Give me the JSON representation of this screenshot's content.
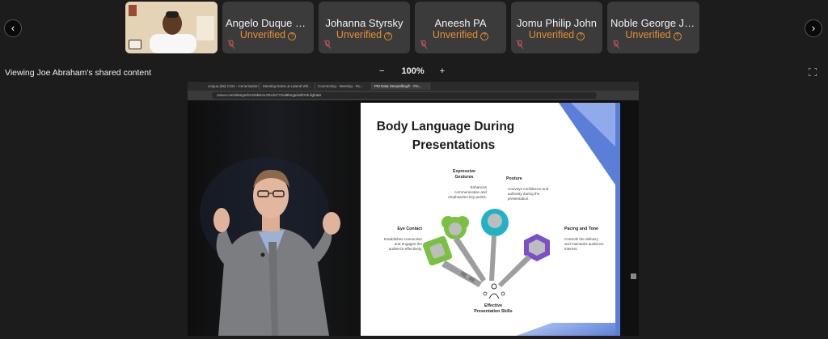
{
  "participants": [
    {
      "name": "Angelo Duque PMP",
      "status": "Unverified"
    },
    {
      "name": "Johanna Styrsky",
      "status": "Unverified"
    },
    {
      "name": "Aneesh PA",
      "status": "Unverified"
    },
    {
      "name": "Jomu Philip John",
      "status": "Unverified"
    },
    {
      "name": "Noble George Jos...",
      "status": "Unverified"
    }
  ],
  "sharing_label": "Viewing Joe Abraham's shared content",
  "zoom": {
    "minus": "−",
    "level": "100%",
    "plus": "+"
  },
  "browser": {
    "tabs": [
      "Joiqua (56) CSIs - Cenerisation",
      "Meeting Notes & Lateral Wh...",
      "Connecting - Meeting - Ro...",
      "PM Data Storytelling® - Fin..."
    ],
    "url": "canva.com/design/DAG6kNAxYEU/uT7Gai8bngp/edit?ek-light&ir"
  },
  "slide": {
    "title_line1": "Body Language During",
    "title_line2": "Presentations",
    "items": {
      "gestures": {
        "label_line1": "Expressive",
        "label_line2": "Gestures",
        "desc": [
          "Enhances",
          "communication and",
          "emphasizes key points."
        ]
      },
      "posture": {
        "label": "Posture",
        "desc": [
          "Conveys confidence and",
          "authority during the",
          "presentation."
        ]
      },
      "eye": {
        "label": "Eye Contact",
        "desc": [
          "Establishes connection",
          "and engages the",
          "audience effectively."
        ]
      },
      "pacing": {
        "label": "Pacing and Tone",
        "desc": [
          "Controls the delivery",
          "and maintains audience",
          "interest."
        ]
      },
      "skills": {
        "label_line1": "Effective",
        "label_line2": "Presentation Skills"
      }
    }
  },
  "colors": {
    "unverified": "#e98f2c",
    "tile_bg": "#3b3b3b",
    "slide_accent": "#5b7fd9",
    "key_green": "#7ac142",
    "key_teal": "#21b2c6",
    "key_purple": "#7c4fc8"
  }
}
